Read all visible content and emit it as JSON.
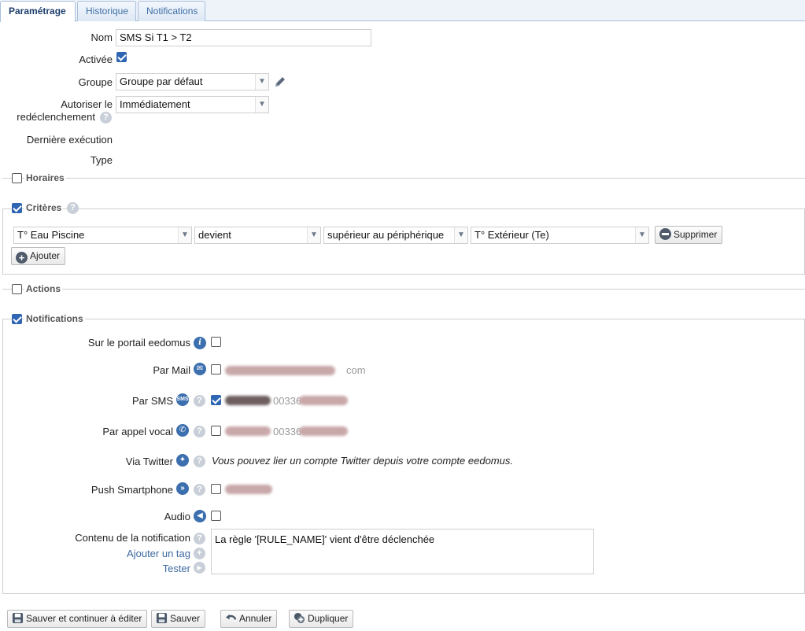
{
  "tabs": [
    "Paramétrage",
    "Historique",
    "Notifications"
  ],
  "form": {
    "nom_label": "Nom",
    "nom_value": "SMS Si T1 > T2",
    "activee_label": "Activée",
    "groupe_label": "Groupe",
    "groupe_value": "Groupe par défaut",
    "autoriser_label_1": "Autoriser le",
    "autoriser_label_2": "redéclenchement",
    "autoriser_value": "Immédiatement",
    "derniere_label": "Dernière exécution",
    "type_label": "Type"
  },
  "sections": {
    "horaires": "Horaires",
    "criteres": "Critères",
    "actions": "Actions",
    "notifications": "Notifications"
  },
  "criteria": {
    "device": "T° Eau Piscine",
    "condition": "devient",
    "operator": "supérieur au périphérique",
    "target": "T° Extérieur (Te)",
    "delete_label": "Supprimer",
    "add_label": "Ajouter"
  },
  "notifications": {
    "portal_label": "Sur le portail eedomus",
    "mail_label": "Par Mail",
    "mail_suffix": "com",
    "sms_label": "Par SMS",
    "sms_number_prefix": "00336",
    "voice_label": "Par appel vocal",
    "voice_number_prefix": "00336",
    "twitter_label": "Via Twitter",
    "twitter_text": "Vous pouvez lier un compte Twitter depuis votre compte eedomus.",
    "push_label": "Push Smartphone",
    "audio_label": "Audio",
    "content_label": "Contenu de la notification",
    "add_tag_label": "Ajouter un tag",
    "test_label": "Tester",
    "content_value": "La règle '[RULE_NAME]' vient d'être déclenchée",
    "sms_icon_text": "SMS"
  },
  "footer": {
    "save_continue": "Sauver et continuer à éditer",
    "save": "Sauver",
    "cancel": "Annuler",
    "duplicate": "Dupliquer"
  },
  "colors": {
    "accent": "#2f66b3",
    "tab_text": "#3f6fa6",
    "link": "#3d6aa0"
  }
}
